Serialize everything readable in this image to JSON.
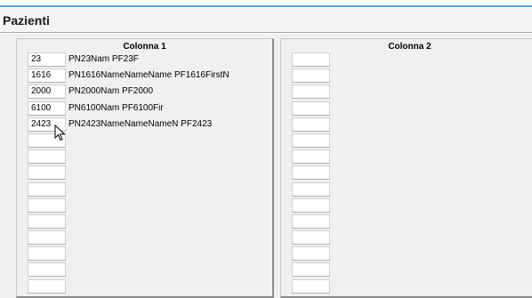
{
  "header": {
    "title": "Pazienti"
  },
  "colors": {
    "accent_line": "#5aa0d8",
    "background": "#f0f0f0"
  },
  "columns": [
    {
      "title": "Colonna 1",
      "rows": [
        {
          "code": "23",
          "name": "PN23Nam PF23F"
        },
        {
          "code": "1616",
          "name": "PN1616NameNameName PF1616FirstN"
        },
        {
          "code": "2000",
          "name": "PN2000Nam PF2000"
        },
        {
          "code": "6100",
          "name": "PN6100Nam PF6100Fir"
        },
        {
          "code": "2423",
          "name": "PN2423NameNameNameN PF2423"
        },
        {
          "code": "",
          "name": ""
        },
        {
          "code": "",
          "name": ""
        },
        {
          "code": "",
          "name": ""
        },
        {
          "code": "",
          "name": ""
        },
        {
          "code": "",
          "name": ""
        },
        {
          "code": "",
          "name": ""
        },
        {
          "code": "",
          "name": ""
        },
        {
          "code": "",
          "name": ""
        },
        {
          "code": "",
          "name": ""
        },
        {
          "code": "",
          "name": ""
        }
      ]
    },
    {
      "title": "Colonna 2",
      "rows": [
        {
          "code": "",
          "name": ""
        },
        {
          "code": "",
          "name": ""
        },
        {
          "code": "",
          "name": ""
        },
        {
          "code": "",
          "name": ""
        },
        {
          "code": "",
          "name": ""
        },
        {
          "code": "",
          "name": ""
        },
        {
          "code": "",
          "name": ""
        },
        {
          "code": "",
          "name": ""
        },
        {
          "code": "",
          "name": ""
        },
        {
          "code": "",
          "name": ""
        },
        {
          "code": "",
          "name": ""
        },
        {
          "code": "",
          "name": ""
        },
        {
          "code": "",
          "name": ""
        },
        {
          "code": "",
          "name": ""
        },
        {
          "code": "",
          "name": ""
        }
      ]
    }
  ]
}
